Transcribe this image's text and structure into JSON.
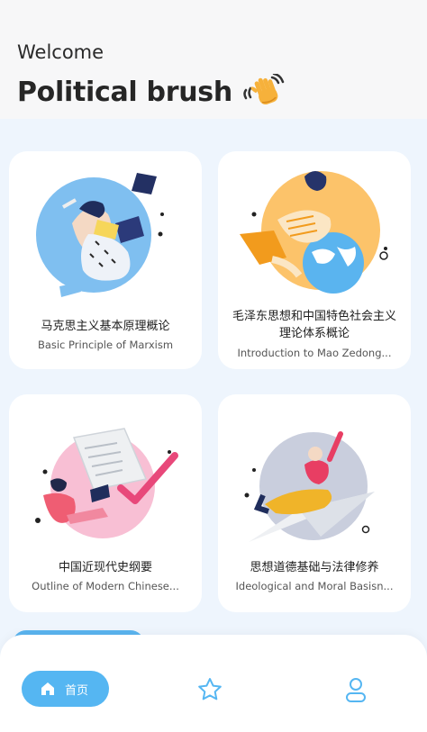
{
  "header": {
    "welcome": "Welcome",
    "title": "Political brush",
    "title_icon": "waving-hand-icon"
  },
  "courses": [
    {
      "title_zh": "马克思主义基本原理概论",
      "title_en": "Basic Principle of Marxism",
      "illustration": "graduate-figure"
    },
    {
      "title_zh": "毛泽东思想和中国特色社会主义理论体系概论",
      "title_en": "Introduction to Mao Zedong...",
      "illustration": "globe-figure"
    },
    {
      "title_zh": "中国近现代史纲要",
      "title_en": "Outline of Modern Chinese...",
      "illustration": "document-checkmark"
    },
    {
      "title_zh": "思想道德基础与法律修养",
      "title_en": "Ideological and Moral Basisn...",
      "illustration": "paper-plane-figure"
    }
  ],
  "nav": {
    "home_label": "首页",
    "home_icon": "home-icon",
    "favorites_icon": "star-icon",
    "profile_icon": "user-icon"
  },
  "colors": {
    "accent": "#55b6f2",
    "background": "#eef5fd",
    "header_bg": "#f7f7f8"
  }
}
